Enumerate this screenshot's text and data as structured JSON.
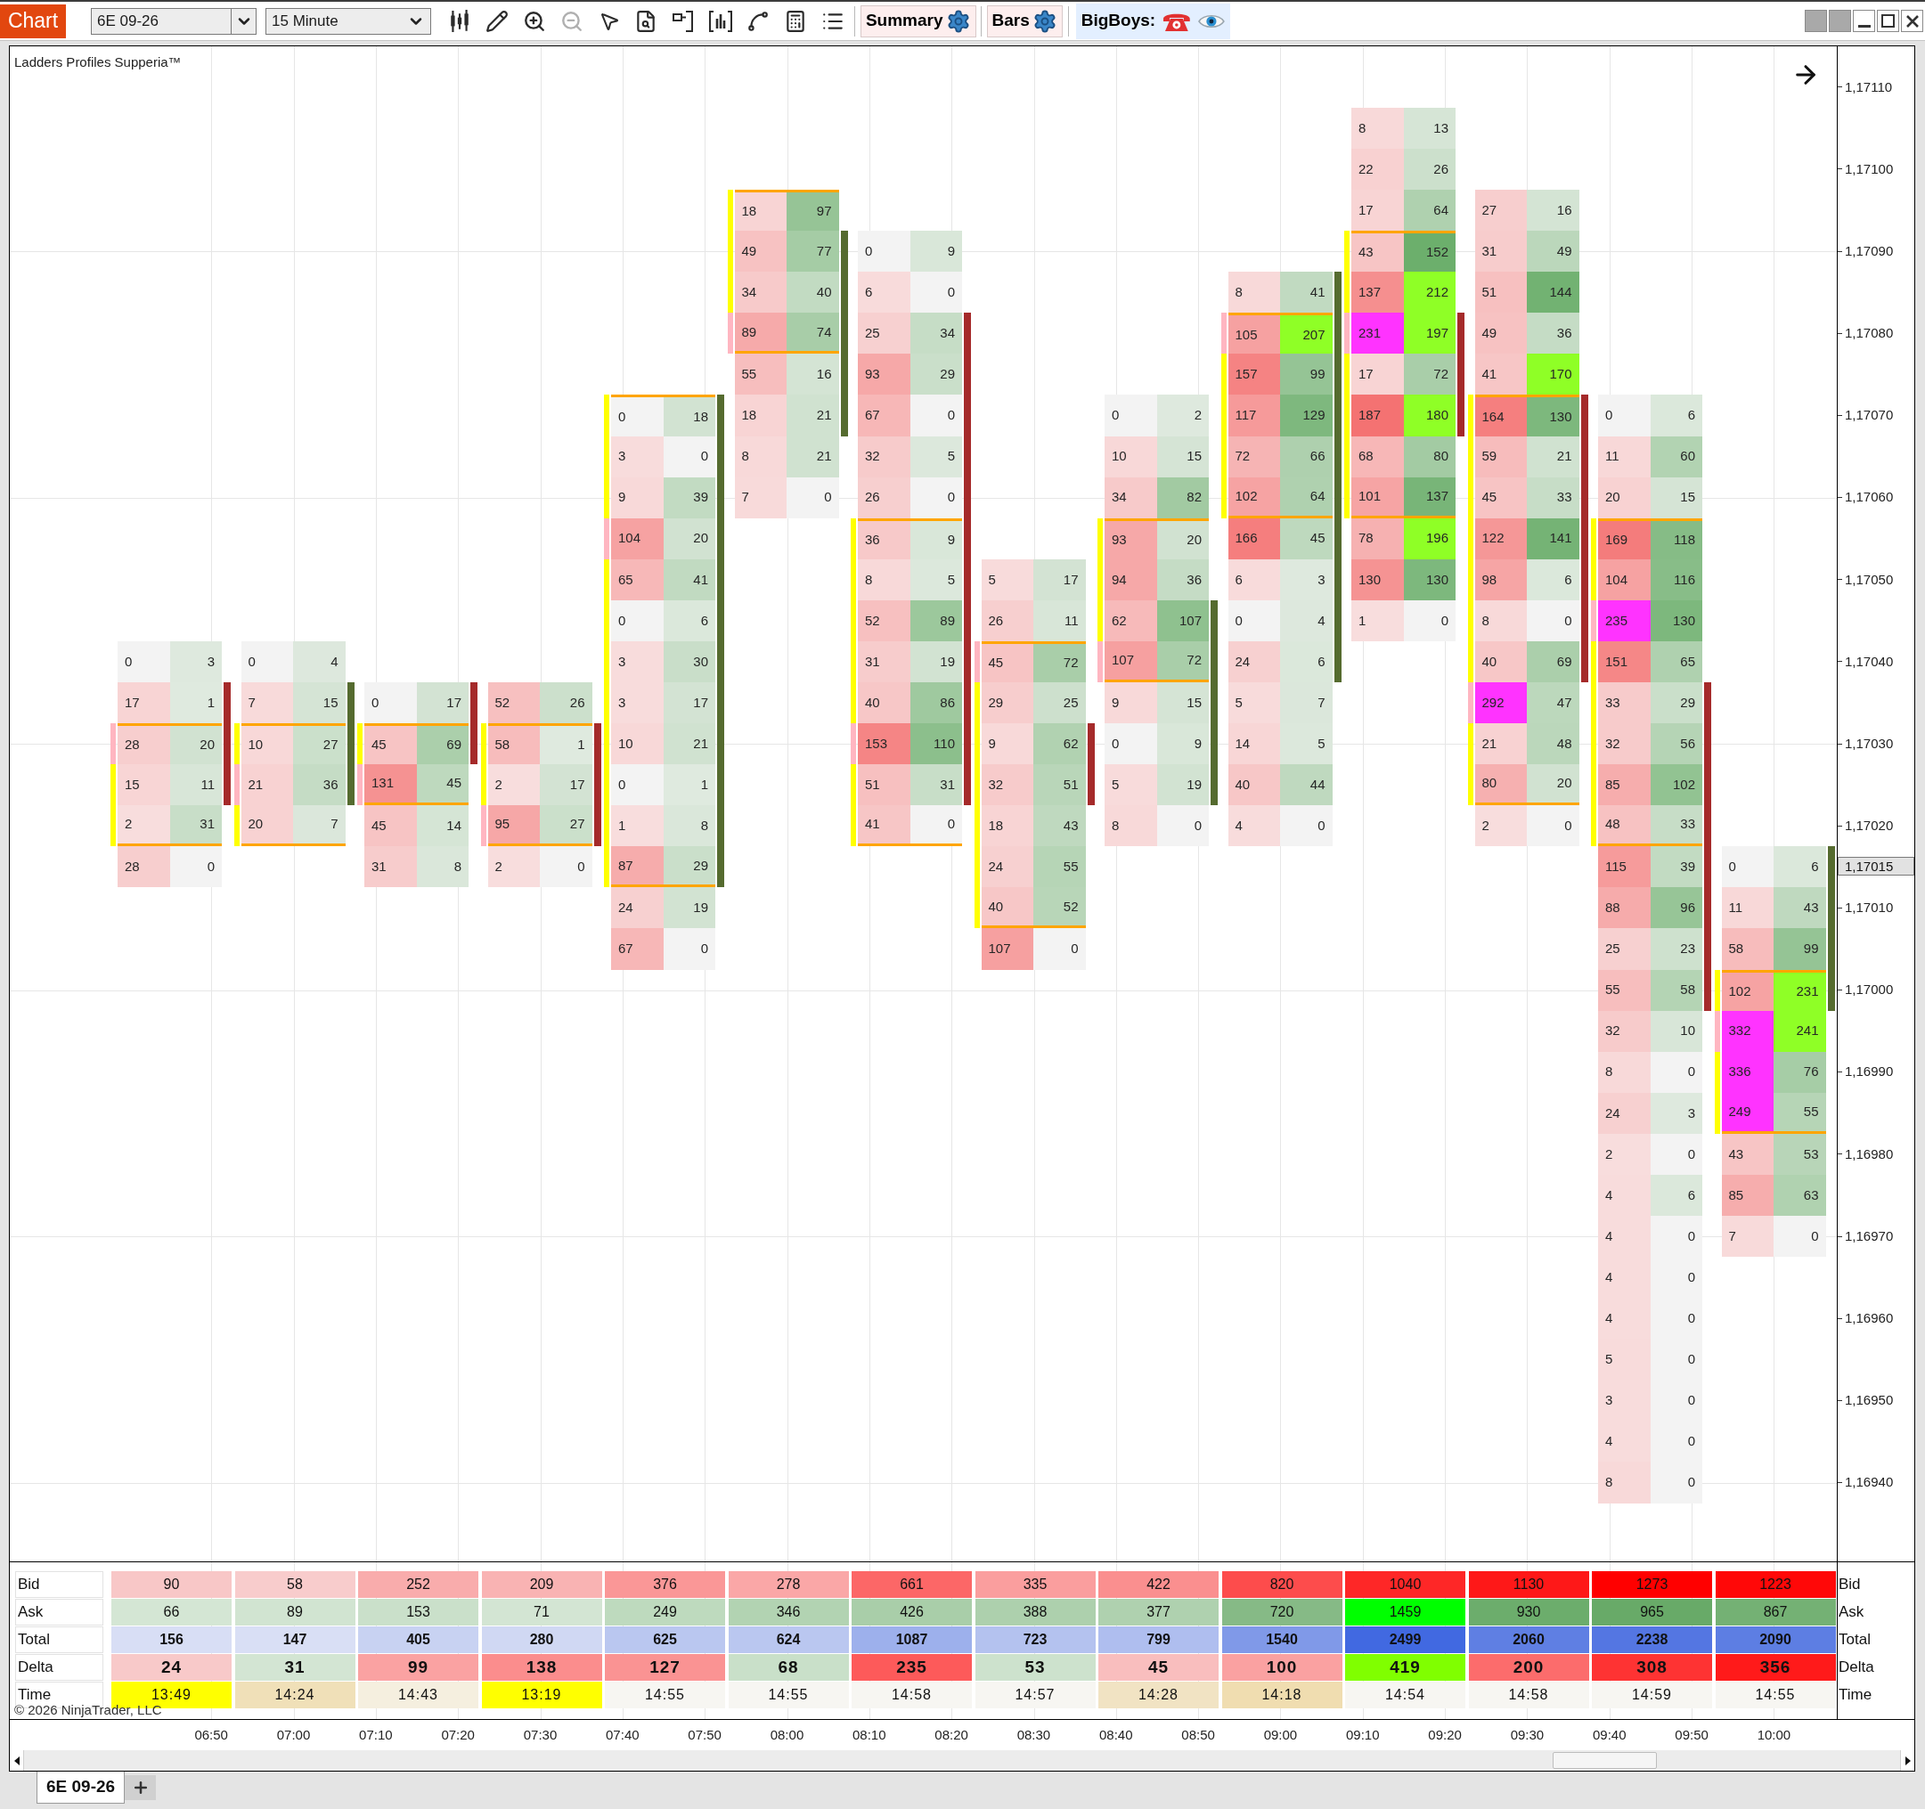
{
  "toolbar": {
    "menu_button": "Chart",
    "instrument": "6E 09-26",
    "interval": "15 Minute",
    "tools": [
      {
        "kind": "candles",
        "disabled": false
      },
      {
        "kind": "pencil",
        "disabled": false
      },
      {
        "kind": "zoom_in",
        "disabled": false
      },
      {
        "kind": "zoom_out",
        "disabled": true
      },
      {
        "kind": "pointer",
        "disabled": false
      },
      {
        "kind": "document_search",
        "disabled": false
      },
      {
        "kind": "bracket_box",
        "disabled": false
      },
      {
        "kind": "bracketed_bars",
        "disabled": false
      },
      {
        "kind": "line_nodes",
        "disabled": false
      },
      {
        "kind": "calculator_sheet",
        "disabled": false
      },
      {
        "kind": "list",
        "disabled": false
      }
    ],
    "indicator_buttons": [
      {
        "label": "Summary"
      },
      {
        "label": "Bars"
      }
    ],
    "bigboys_label": "BigBoys:"
  },
  "chart": {
    "title": "Ladders Profiles Supperia™",
    "price_axis": [
      {
        "label": "1,17110",
        "kind": "tick"
      },
      {
        "label": "1,17100",
        "kind": "tick"
      },
      {
        "label": "1,17090",
        "kind": "tick"
      },
      {
        "label": "1,17080",
        "kind": "tick"
      },
      {
        "label": "1,17070",
        "kind": "tick"
      },
      {
        "label": "1,17060",
        "kind": "tick"
      },
      {
        "label": "1,17050",
        "kind": "tick"
      },
      {
        "label": "1,17040",
        "kind": "tick"
      },
      {
        "label": "1,17030",
        "kind": "tick"
      },
      {
        "label": "1,17020",
        "kind": "tick"
      },
      {
        "label": "1,17015",
        "kind": "current"
      },
      {
        "label": "1,17010",
        "kind": "tick"
      },
      {
        "label": "1,17000",
        "kind": "tick"
      },
      {
        "label": "1,16990",
        "kind": "tick"
      },
      {
        "label": "1,16980",
        "kind": "tick"
      },
      {
        "label": "1,16970",
        "kind": "tick"
      },
      {
        "label": "1,16960",
        "kind": "tick"
      },
      {
        "label": "1,16950",
        "kind": "tick"
      },
      {
        "label": "1,16940",
        "kind": "tick"
      }
    ],
    "bars": [
      {
        "kind": "down",
        "rows": [
          {
            "kind": "gap"
          },
          {
            "kind": "gap"
          },
          {
            "kind": "gap"
          },
          {
            "kind": "gap"
          },
          {
            "kind": "gap"
          },
          {
            "kind": "gap"
          },
          {
            "kind": "gap"
          },
          {
            "kind": "gap"
          },
          {
            "kind": "gap"
          },
          {
            "kind": "gap"
          },
          {
            "kind": "gap"
          },
          {
            "kind": "gap"
          },
          {
            "kind": "gap"
          },
          {
            "kind": "gap"
          },
          {
            "bid": "0",
            "ask": "3",
            "kind": "outside",
            "body": false
          },
          {
            "bid": "17",
            "ask": "1",
            "kind": "outside",
            "body": true
          },
          {
            "bid": "28",
            "ask": "20",
            "kind": "poc",
            "body": true
          },
          {
            "bid": "15",
            "ask": "11",
            "kind": "value_area",
            "body": true
          },
          {
            "bid": "2",
            "ask": "31",
            "kind": "value_area",
            "body": false
          },
          {
            "bid": "28",
            "ask": "0",
            "kind": "outside",
            "body": false
          }
        ]
      },
      {
        "kind": "up",
        "rows": [
          {
            "kind": "gap"
          },
          {
            "kind": "gap"
          },
          {
            "kind": "gap"
          },
          {
            "kind": "gap"
          },
          {
            "kind": "gap"
          },
          {
            "kind": "gap"
          },
          {
            "kind": "gap"
          },
          {
            "kind": "gap"
          },
          {
            "kind": "gap"
          },
          {
            "kind": "gap"
          },
          {
            "kind": "gap"
          },
          {
            "kind": "gap"
          },
          {
            "kind": "gap"
          },
          {
            "kind": "gap"
          },
          {
            "bid": "0",
            "ask": "4",
            "kind": "outside",
            "body": false
          },
          {
            "bid": "7",
            "ask": "15",
            "kind": "outside",
            "body": true
          },
          {
            "bid": "10",
            "ask": "27",
            "kind": "value_area",
            "body": true
          },
          {
            "bid": "21",
            "ask": "36",
            "kind": "poc",
            "body": true
          },
          {
            "bid": "20",
            "ask": "7",
            "kind": "value_area",
            "body": false
          }
        ]
      },
      {
        "kind": "down",
        "rows": [
          {
            "kind": "gap"
          },
          {
            "kind": "gap"
          },
          {
            "kind": "gap"
          },
          {
            "kind": "gap"
          },
          {
            "kind": "gap"
          },
          {
            "kind": "gap"
          },
          {
            "kind": "gap"
          },
          {
            "kind": "gap"
          },
          {
            "kind": "gap"
          },
          {
            "kind": "gap"
          },
          {
            "kind": "gap"
          },
          {
            "kind": "gap"
          },
          {
            "kind": "gap"
          },
          {
            "kind": "gap"
          },
          {
            "kind": "gap"
          },
          {
            "bid": "0",
            "ask": "17",
            "kind": "outside",
            "body": true
          },
          {
            "bid": "45",
            "ask": "69",
            "kind": "value_area",
            "body": true
          },
          {
            "bid": "131",
            "ask": "45",
            "kind": "poc",
            "body": false
          },
          {
            "bid": "45",
            "ask": "14",
            "kind": "outside",
            "body": false
          },
          {
            "bid": "31",
            "ask": "8",
            "kind": "outside",
            "body": false
          }
        ]
      },
      {
        "kind": "down",
        "rows": [
          {
            "kind": "gap"
          },
          {
            "kind": "gap"
          },
          {
            "kind": "gap"
          },
          {
            "kind": "gap"
          },
          {
            "kind": "gap"
          },
          {
            "kind": "gap"
          },
          {
            "kind": "gap"
          },
          {
            "kind": "gap"
          },
          {
            "kind": "gap"
          },
          {
            "kind": "gap"
          },
          {
            "kind": "gap"
          },
          {
            "kind": "gap"
          },
          {
            "kind": "gap"
          },
          {
            "kind": "gap"
          },
          {
            "kind": "gap"
          },
          {
            "bid": "52",
            "ask": "26",
            "kind": "outside",
            "body": false
          },
          {
            "bid": "58",
            "ask": "1",
            "kind": "value_area",
            "body": true
          },
          {
            "bid": "2",
            "ask": "17",
            "kind": "value_area",
            "body": true
          },
          {
            "bid": "95",
            "ask": "27",
            "kind": "poc",
            "body": true
          },
          {
            "bid": "2",
            "ask": "0",
            "kind": "outside",
            "body": false
          }
        ]
      },
      {
        "kind": "up",
        "rows": [
          {
            "kind": "gap"
          },
          {
            "kind": "gap"
          },
          {
            "kind": "gap"
          },
          {
            "kind": "gap"
          },
          {
            "kind": "gap"
          },
          {
            "kind": "gap"
          },
          {
            "kind": "gap"
          },
          {
            "kind": "gap"
          },
          {
            "bid": "0",
            "ask": "18",
            "kind": "value_area",
            "body": true
          },
          {
            "bid": "3",
            "ask": "0",
            "kind": "value_area",
            "body": true
          },
          {
            "bid": "9",
            "ask": "39",
            "kind": "value_area",
            "body": true
          },
          {
            "bid": "104",
            "ask": "20",
            "kind": "poc",
            "body": true
          },
          {
            "bid": "65",
            "ask": "41",
            "kind": "value_area",
            "body": true
          },
          {
            "bid": "0",
            "ask": "6",
            "kind": "value_area",
            "body": true
          },
          {
            "bid": "3",
            "ask": "30",
            "kind": "value_area",
            "body": true
          },
          {
            "bid": "3",
            "ask": "17",
            "kind": "value_area",
            "body": true
          },
          {
            "bid": "10",
            "ask": "21",
            "kind": "value_area",
            "body": true
          },
          {
            "bid": "0",
            "ask": "1",
            "kind": "value_area",
            "body": true
          },
          {
            "bid": "1",
            "ask": "8",
            "kind": "value_area",
            "body": true
          },
          {
            "bid": "87",
            "ask": "29",
            "kind": "value_area",
            "body": true
          },
          {
            "bid": "24",
            "ask": "19",
            "kind": "outside",
            "body": false
          },
          {
            "bid": "67",
            "ask": "0",
            "kind": "outside",
            "body": false
          }
        ]
      },
      {
        "kind": "up",
        "rows": [
          {
            "kind": "gap"
          },
          {
            "kind": "gap"
          },
          {
            "kind": "gap"
          },
          {
            "bid": "18",
            "ask": "97",
            "kind": "value_area",
            "body": false
          },
          {
            "bid": "49",
            "ask": "77",
            "kind": "value_area",
            "body": true
          },
          {
            "bid": "34",
            "ask": "40",
            "kind": "value_area",
            "body": true
          },
          {
            "bid": "89",
            "ask": "74",
            "kind": "poc",
            "body": true
          },
          {
            "bid": "55",
            "ask": "16",
            "kind": "outside",
            "body": true
          },
          {
            "bid": "18",
            "ask": "21",
            "kind": "outside",
            "body": true
          },
          {
            "bid": "8",
            "ask": "21",
            "kind": "outside",
            "body": false
          },
          {
            "bid": "7",
            "ask": "0",
            "kind": "outside",
            "body": false
          }
        ]
      },
      {
        "kind": "down",
        "rows": [
          {
            "kind": "gap"
          },
          {
            "kind": "gap"
          },
          {
            "kind": "gap"
          },
          {
            "kind": "gap"
          },
          {
            "bid": "0",
            "ask": "9",
            "kind": "outside",
            "body": false
          },
          {
            "bid": "6",
            "ask": "0",
            "kind": "outside",
            "body": false
          },
          {
            "bid": "25",
            "ask": "34",
            "kind": "outside",
            "body": true
          },
          {
            "bid": "93",
            "ask": "29",
            "kind": "outside",
            "body": true
          },
          {
            "bid": "67",
            "ask": "0",
            "kind": "outside",
            "body": true
          },
          {
            "bid": "32",
            "ask": "5",
            "kind": "outside",
            "body": true
          },
          {
            "bid": "26",
            "ask": "0",
            "kind": "outside",
            "body": true
          },
          {
            "bid": "36",
            "ask": "9",
            "kind": "value_area",
            "body": true
          },
          {
            "bid": "8",
            "ask": "5",
            "kind": "value_area",
            "body": true
          },
          {
            "bid": "52",
            "ask": "89",
            "kind": "value_area",
            "body": true
          },
          {
            "bid": "31",
            "ask": "19",
            "kind": "value_area",
            "body": true
          },
          {
            "bid": "40",
            "ask": "86",
            "kind": "value_area",
            "body": true
          },
          {
            "bid": "153",
            "ask": "110",
            "kind": "poc",
            "body": true
          },
          {
            "bid": "51",
            "ask": "31",
            "kind": "value_area",
            "body": true
          },
          {
            "bid": "41",
            "ask": "0",
            "kind": "value_area",
            "body": false
          }
        ]
      },
      {
        "kind": "down",
        "rows": [
          {
            "kind": "gap"
          },
          {
            "kind": "gap"
          },
          {
            "kind": "gap"
          },
          {
            "kind": "gap"
          },
          {
            "kind": "gap"
          },
          {
            "kind": "gap"
          },
          {
            "kind": "gap"
          },
          {
            "kind": "gap"
          },
          {
            "kind": "gap"
          },
          {
            "kind": "gap"
          },
          {
            "kind": "gap"
          },
          {
            "kind": "gap"
          },
          {
            "bid": "5",
            "ask": "17",
            "kind": "outside",
            "body": false
          },
          {
            "bid": "26",
            "ask": "11",
            "kind": "outside",
            "body": false
          },
          {
            "bid": "45",
            "ask": "72",
            "kind": "poc",
            "body": false
          },
          {
            "bid": "29",
            "ask": "25",
            "kind": "value_area",
            "body": false
          },
          {
            "bid": "9",
            "ask": "62",
            "kind": "value_area",
            "body": true
          },
          {
            "bid": "32",
            "ask": "51",
            "kind": "value_area",
            "body": true
          },
          {
            "bid": "18",
            "ask": "43",
            "kind": "value_area",
            "body": false
          },
          {
            "bid": "24",
            "ask": "55",
            "kind": "value_area",
            "body": false
          },
          {
            "bid": "40",
            "ask": "52",
            "kind": "value_area",
            "body": false
          },
          {
            "bid": "107",
            "ask": "0",
            "kind": "outside",
            "body": false
          }
        ]
      },
      {
        "kind": "up",
        "rows": [
          {
            "kind": "gap"
          },
          {
            "kind": "gap"
          },
          {
            "kind": "gap"
          },
          {
            "kind": "gap"
          },
          {
            "kind": "gap"
          },
          {
            "kind": "gap"
          },
          {
            "kind": "gap"
          },
          {
            "kind": "gap"
          },
          {
            "bid": "0",
            "ask": "2",
            "kind": "outside",
            "body": false
          },
          {
            "bid": "10",
            "ask": "15",
            "kind": "outside",
            "body": false
          },
          {
            "bid": "34",
            "ask": "82",
            "kind": "outside",
            "body": false
          },
          {
            "bid": "93",
            "ask": "20",
            "kind": "value_area",
            "body": false
          },
          {
            "bid": "94",
            "ask": "36",
            "kind": "value_area",
            "body": false
          },
          {
            "bid": "62",
            "ask": "107",
            "kind": "value_area",
            "body": true
          },
          {
            "bid": "107",
            "ask": "72",
            "kind": "poc",
            "body": true
          },
          {
            "bid": "9",
            "ask": "15",
            "kind": "outside",
            "body": true
          },
          {
            "bid": "0",
            "ask": "9",
            "kind": "outside",
            "body": true
          },
          {
            "bid": "5",
            "ask": "19",
            "kind": "outside",
            "body": true
          },
          {
            "bid": "8",
            "ask": "0",
            "kind": "outside",
            "body": false
          }
        ]
      },
      {
        "kind": "up",
        "rows": [
          {
            "kind": "gap"
          },
          {
            "kind": "gap"
          },
          {
            "kind": "gap"
          },
          {
            "kind": "gap"
          },
          {
            "kind": "gap"
          },
          {
            "bid": "8",
            "ask": "41",
            "kind": "outside",
            "body": true
          },
          {
            "bid": "105",
            "ask": "207",
            "kind": "poc",
            "body": true
          },
          {
            "bid": "157",
            "ask": "99",
            "kind": "value_area",
            "body": true
          },
          {
            "bid": "117",
            "ask": "129",
            "kind": "value_area",
            "body": true
          },
          {
            "bid": "72",
            "ask": "66",
            "kind": "value_area",
            "body": true
          },
          {
            "bid": "102",
            "ask": "64",
            "kind": "value_area",
            "body": true
          },
          {
            "bid": "166",
            "ask": "45",
            "kind": "outside",
            "body": true
          },
          {
            "bid": "6",
            "ask": "3",
            "kind": "outside",
            "body": true
          },
          {
            "bid": "0",
            "ask": "4",
            "kind": "outside",
            "body": true
          },
          {
            "bid": "24",
            "ask": "6",
            "kind": "outside",
            "body": true
          },
          {
            "bid": "5",
            "ask": "7",
            "kind": "outside",
            "body": false
          },
          {
            "bid": "14",
            "ask": "5",
            "kind": "outside",
            "body": false
          },
          {
            "bid": "40",
            "ask": "44",
            "kind": "outside",
            "body": false
          },
          {
            "bid": "4",
            "ask": "0",
            "kind": "outside",
            "body": false
          }
        ]
      },
      {
        "kind": "down",
        "rows": [
          {
            "kind": "gap"
          },
          {
            "bid": "8",
            "ask": "13",
            "kind": "outside",
            "body": false
          },
          {
            "bid": "22",
            "ask": "26",
            "kind": "outside",
            "body": false
          },
          {
            "bid": "17",
            "ask": "64",
            "kind": "outside",
            "body": false
          },
          {
            "bid": "43",
            "ask": "152",
            "kind": "value_area",
            "body": false
          },
          {
            "bid": "137",
            "ask": "212",
            "kind": "value_area",
            "body": false
          },
          {
            "bid": "231",
            "ask": "197",
            "kind": "poc",
            "body": true
          },
          {
            "bid": "17",
            "ask": "72",
            "kind": "value_area",
            "body": true
          },
          {
            "bid": "187",
            "ask": "180",
            "kind": "value_area",
            "body": true
          },
          {
            "bid": "68",
            "ask": "80",
            "kind": "value_area",
            "body": false
          },
          {
            "bid": "101",
            "ask": "137",
            "kind": "value_area",
            "body": false
          },
          {
            "bid": "78",
            "ask": "196",
            "kind": "outside",
            "body": false
          },
          {
            "bid": "130",
            "ask": "130",
            "kind": "outside",
            "body": false
          },
          {
            "bid": "1",
            "ask": "0",
            "kind": "outside",
            "body": false
          }
        ]
      },
      {
        "kind": "down",
        "rows": [
          {
            "kind": "gap"
          },
          {
            "kind": "gap"
          },
          {
            "kind": "gap"
          },
          {
            "bid": "27",
            "ask": "16",
            "kind": "outside",
            "body": false
          },
          {
            "bid": "31",
            "ask": "49",
            "kind": "outside",
            "body": false
          },
          {
            "bid": "51",
            "ask": "144",
            "kind": "outside",
            "body": false
          },
          {
            "bid": "49",
            "ask": "36",
            "kind": "outside",
            "body": false
          },
          {
            "bid": "41",
            "ask": "170",
            "kind": "outside",
            "body": false
          },
          {
            "bid": "164",
            "ask": "130",
            "kind": "value_area",
            "body": true
          },
          {
            "bid": "59",
            "ask": "21",
            "kind": "value_area",
            "body": true
          },
          {
            "bid": "45",
            "ask": "33",
            "kind": "value_area",
            "body": true
          },
          {
            "bid": "122",
            "ask": "141",
            "kind": "value_area",
            "body": true
          },
          {
            "bid": "98",
            "ask": "6",
            "kind": "value_area",
            "body": true
          },
          {
            "bid": "8",
            "ask": "0",
            "kind": "value_area",
            "body": true
          },
          {
            "bid": "40",
            "ask": "69",
            "kind": "value_area",
            "body": true
          },
          {
            "bid": "292",
            "ask": "47",
            "kind": "poc",
            "body": false
          },
          {
            "bid": "21",
            "ask": "48",
            "kind": "value_area",
            "body": false
          },
          {
            "bid": "80",
            "ask": "20",
            "kind": "value_area",
            "body": false
          },
          {
            "bid": "2",
            "ask": "0",
            "kind": "outside",
            "body": false
          }
        ]
      },
      {
        "kind": "down",
        "rows": [
          {
            "kind": "gap"
          },
          {
            "kind": "gap"
          },
          {
            "kind": "gap"
          },
          {
            "kind": "gap"
          },
          {
            "kind": "gap"
          },
          {
            "kind": "gap"
          },
          {
            "kind": "gap"
          },
          {
            "kind": "gap"
          },
          {
            "bid": "0",
            "ask": "6",
            "kind": "outside",
            "body": false
          },
          {
            "bid": "11",
            "ask": "60",
            "kind": "outside",
            "body": false
          },
          {
            "bid": "20",
            "ask": "15",
            "kind": "outside",
            "body": false
          },
          {
            "bid": "169",
            "ask": "118",
            "kind": "value_area",
            "body": false
          },
          {
            "bid": "104",
            "ask": "116",
            "kind": "value_area",
            "body": false
          },
          {
            "bid": "235",
            "ask": "130",
            "kind": "poc",
            "body": false
          },
          {
            "bid": "151",
            "ask": "65",
            "kind": "value_area",
            "body": false
          },
          {
            "bid": "33",
            "ask": "29",
            "kind": "value_area",
            "body": true
          },
          {
            "bid": "32",
            "ask": "56",
            "kind": "value_area",
            "body": true
          },
          {
            "bid": "85",
            "ask": "102",
            "kind": "value_area",
            "body": true
          },
          {
            "bid": "48",
            "ask": "33",
            "kind": "value_area",
            "body": true
          },
          {
            "bid": "115",
            "ask": "39",
            "kind": "outside",
            "body": true
          },
          {
            "bid": "88",
            "ask": "96",
            "kind": "outside",
            "body": true
          },
          {
            "bid": "25",
            "ask": "23",
            "kind": "outside",
            "body": true
          },
          {
            "bid": "55",
            "ask": "58",
            "kind": "outside",
            "body": true
          },
          {
            "bid": "32",
            "ask": "10",
            "kind": "outside",
            "body": false
          },
          {
            "bid": "8",
            "ask": "0",
            "kind": "outside",
            "body": false
          },
          {
            "bid": "24",
            "ask": "3",
            "kind": "outside",
            "body": false
          },
          {
            "bid": "2",
            "ask": "0",
            "kind": "outside",
            "body": false
          },
          {
            "bid": "4",
            "ask": "6",
            "kind": "outside",
            "body": false
          },
          {
            "bid": "4",
            "ask": "0",
            "kind": "outside",
            "body": false
          },
          {
            "bid": "4",
            "ask": "0",
            "kind": "outside",
            "body": false
          },
          {
            "bid": "4",
            "ask": "0",
            "kind": "outside",
            "body": false
          },
          {
            "bid": "5",
            "ask": "0",
            "kind": "outside",
            "body": false
          },
          {
            "bid": "3",
            "ask": "0",
            "kind": "outside",
            "body": false
          },
          {
            "bid": "4",
            "ask": "0",
            "kind": "outside",
            "body": false
          },
          {
            "bid": "8",
            "ask": "0",
            "kind": "outside",
            "body": false
          }
        ]
      },
      {
        "kind": "up",
        "rows": [
          {
            "kind": "gap"
          },
          {
            "kind": "gap"
          },
          {
            "kind": "gap"
          },
          {
            "kind": "gap"
          },
          {
            "kind": "gap"
          },
          {
            "kind": "gap"
          },
          {
            "kind": "gap"
          },
          {
            "kind": "gap"
          },
          {
            "kind": "gap"
          },
          {
            "kind": "gap"
          },
          {
            "kind": "gap"
          },
          {
            "kind": "gap"
          },
          {
            "kind": "gap"
          },
          {
            "kind": "gap"
          },
          {
            "kind": "gap"
          },
          {
            "kind": "gap"
          },
          {
            "kind": "gap"
          },
          {
            "kind": "gap"
          },
          {
            "kind": "gap"
          },
          {
            "bid": "0",
            "ask": "6",
            "kind": "outside",
            "body": true
          },
          {
            "bid": "11",
            "ask": "43",
            "kind": "outside",
            "body": true
          },
          {
            "bid": "58",
            "ask": "99",
            "kind": "outside",
            "body": true
          },
          {
            "bid": "102",
            "ask": "231",
            "kind": "value_area",
            "body": true
          },
          {
            "bid": "332",
            "ask": "241",
            "kind": "poc",
            "body": false
          },
          {
            "bid": "336",
            "ask": "76",
            "kind": "value_area",
            "body": false
          },
          {
            "bid": "249",
            "ask": "55",
            "kind": "value_area",
            "body": false
          },
          {
            "bid": "43",
            "ask": "53",
            "kind": "outside",
            "body": false
          },
          {
            "bid": "85",
            "ask": "63",
            "kind": "outside",
            "body": false
          },
          {
            "bid": "7",
            "ask": "0",
            "kind": "outside",
            "body": false
          }
        ]
      }
    ]
  },
  "summary": {
    "rows": [
      {
        "kind": "bid",
        "label": "Bid",
        "label_right": "Bid",
        "cells": [
          "90",
          "58",
          "252",
          "209",
          "376",
          "278",
          "661",
          "335",
          "422",
          "820",
          "1040",
          "1130",
          "1273",
          "1223"
        ]
      },
      {
        "kind": "ask",
        "label": "Ask",
        "label_right": "Ask",
        "cells": [
          "66",
          "89",
          "153",
          "71",
          "249",
          "346",
          "426",
          "388",
          "377",
          "720",
          "1459",
          "930",
          "965",
          "867"
        ]
      },
      {
        "kind": "total",
        "label": "Total",
        "label_right": "Total",
        "cells": [
          "156",
          "147",
          "405",
          "280",
          "625",
          "624",
          "1087",
          "723",
          "799",
          "1540",
          "2499",
          "2060",
          "2238",
          "2090"
        ]
      },
      {
        "kind": "delta",
        "label": "Delta",
        "label_right": "Delta",
        "cells": [
          {
            "text": "24",
            "negative": true
          },
          {
            "text": "31",
            "negative": false
          },
          {
            "text": "99",
            "negative": true
          },
          {
            "text": "138",
            "negative": true
          },
          {
            "text": "127",
            "negative": true
          },
          {
            "text": "68",
            "negative": false
          },
          {
            "text": "235",
            "negative": true
          },
          {
            "text": "53",
            "negative": false
          },
          {
            "text": "45",
            "negative": true
          },
          {
            "text": "100",
            "negative": true
          },
          {
            "text": "419",
            "negative": false
          },
          {
            "text": "200",
            "negative": true
          },
          {
            "text": "308",
            "negative": true
          },
          {
            "text": "356",
            "negative": true
          }
        ]
      },
      {
        "kind": "time",
        "label": "Time",
        "label_right": "Time",
        "cells": [
          {
            "text": "13:49",
            "color": "#ffff00"
          },
          {
            "text": "14:24",
            "color": "#f0e0b8"
          },
          {
            "text": "14:43",
            "color": "#f5efdf"
          },
          {
            "text": "13:19",
            "color": "#ffff00"
          },
          {
            "text": "14:55",
            "color": "#f7f6f2"
          },
          {
            "text": "14:55",
            "color": "#f7f6f2"
          },
          {
            "text": "14:58",
            "color": "#f7f6f2"
          },
          {
            "text": "14:57",
            "color": "#f7f6f2"
          },
          {
            "text": "14:28",
            "color": "#f1e3c3"
          },
          {
            "text": "14:18",
            "color": "#f0ddb0"
          },
          {
            "text": "14:54",
            "color": "#f7f6f2"
          },
          {
            "text": "14:58",
            "color": "#f7f6f2"
          },
          {
            "text": "14:59",
            "color": "#f7f6f2"
          },
          {
            "text": "14:55",
            "color": "#f7f6f2"
          }
        ]
      }
    ]
  },
  "copyright": "© 2026 NinjaTrader, LLC",
  "time_axis": {
    "labels": [
      "06:50",
      "07:00",
      "07:10",
      "07:20",
      "07:30",
      "07:40",
      "07:50",
      "08:00",
      "08:10",
      "08:20",
      "08:30",
      "08:40",
      "08:50",
      "09:00",
      "09:10",
      "09:20",
      "09:30",
      "09:40",
      "09:50",
      "10:00"
    ]
  },
  "tabs": [
    {
      "label": "6E 09-26",
      "selected": true
    }
  ]
}
